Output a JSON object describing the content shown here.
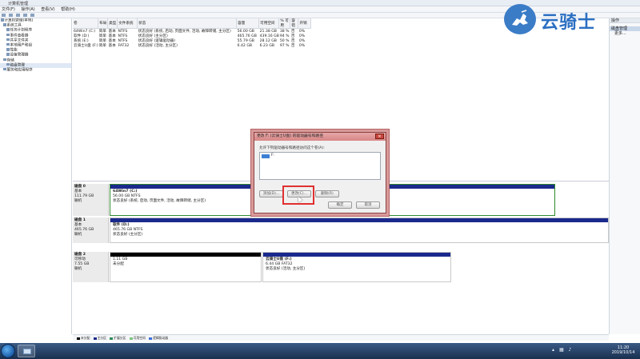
{
  "window": {
    "title": "计算机管理"
  },
  "menu": [
    "文件(F)",
    "操作(A)",
    "查看(V)",
    "帮助(H)"
  ],
  "tree": [
    {
      "label": "计算机管理(本地)",
      "indent": 0
    },
    {
      "label": "系统工具",
      "indent": 1
    },
    {
      "label": "任务计划程序",
      "indent": 2
    },
    {
      "label": "事件查看器",
      "indent": 2
    },
    {
      "label": "共享文件夹",
      "indent": 2
    },
    {
      "label": "本地用户和组",
      "indent": 2
    },
    {
      "label": "性能",
      "indent": 2
    },
    {
      "label": "设备管理器",
      "indent": 2
    },
    {
      "label": "存储",
      "indent": 1
    },
    {
      "label": "磁盘管理",
      "indent": 2
    },
    {
      "label": "服务和应用程序",
      "indent": 1
    }
  ],
  "volume_table": {
    "headers": [
      "卷",
      "布局",
      "类型",
      "文件系统",
      "状态",
      "容量",
      "可用空间",
      "% 可用",
      "容错",
      "开销"
    ],
    "rows": [
      [
        "64Win7 (C:)",
        "简单",
        "基本",
        "NTFS",
        "状态良好 (系统, 启动, 页面文件, 活动, 故障转储, 主分区)",
        "56.00 GB",
        "21.38 GB",
        "38 %",
        "否",
        "0%"
      ],
      [
        "软件 (D:)",
        "简单",
        "基本",
        "NTFS",
        "状态良好 (主分区)",
        "465.76 GB",
        "439.16 GB",
        "94 %",
        "否",
        "0%"
      ],
      [
        "系统 (E:)",
        "简单",
        "基本",
        "NTFS",
        "状态良好 (逻辑驱动器)",
        "55.79 GB",
        "28.12 GB",
        "50 %",
        "否",
        "0%"
      ],
      [
        "云骑士U盘 (F:)",
        "简单",
        "基本",
        "FAT32",
        "状态良好 (活动, 主分区)",
        "6.42 GB",
        "6.23 GB",
        "97 %",
        "否",
        "0%"
      ]
    ]
  },
  "actions": {
    "header": "操作",
    "section": "磁盘管理",
    "more": "更多..."
  },
  "disks": [
    {
      "name": "磁盘 0",
      "type": "基本",
      "size": "111.79 GB",
      "status": "联机",
      "partitions": [
        {
          "label": "64Win7 (C:)",
          "size": "56.00 GB NTFS",
          "status": "状态良好 (系统, 启动, 页面文件, 活动, 故障转储, 主分区)",
          "color": "#1a2a8c"
        }
      ]
    },
    {
      "name": "磁盘 1",
      "type": "基本",
      "size": "465.76 GB",
      "status": "联机",
      "partitions": [
        {
          "label": "软件 (D:)",
          "size": "465.76 GB NTFS",
          "status": "状态良好 (主分区)",
          "color": "#1a2a8c"
        }
      ]
    },
    {
      "name": "磁盘 2",
      "type": "可移动",
      "size": "7.55 GB",
      "status": "联机",
      "partitions": [
        {
          "label": "",
          "size": "1.11 GB",
          "status": "未分配",
          "color": "#000000"
        },
        {
          "label": "云骑士U盘 (F:)",
          "size": "6.44 GB FAT32",
          "status": "状态良好 (活动, 主分区)",
          "color": "#1a2a8c"
        }
      ]
    }
  ],
  "legend": [
    {
      "label": "未分配",
      "color": "#000000"
    },
    {
      "label": "主分区",
      "color": "#1a2a8c"
    },
    {
      "label": "扩展分区",
      "color": "#2e8b57"
    },
    {
      "label": "可用空间",
      "color": "#7cc47c"
    },
    {
      "label": "逻辑驱动器",
      "color": "#3e6fd8"
    }
  ],
  "dialog": {
    "title": "更改 F: (云骑士U盘) 的驱动器号和路径",
    "instruction": "允许下列驱动器号和路径访问这个卷(A):",
    "list_item": "F:",
    "buttons": {
      "add": "添加(D)...",
      "change": "更改(C)...",
      "remove": "删除(R)",
      "ok": "确定",
      "cancel": "取消"
    }
  },
  "logo": {
    "text": "云骑士"
  },
  "taskbar": {
    "time": "11:20",
    "date": "2019/10/14"
  },
  "colors": {
    "primary_partition": "#1a2a8c",
    "unallocated": "#000000",
    "dialog_frame": "#d88686",
    "highlight": "#e03030"
  }
}
